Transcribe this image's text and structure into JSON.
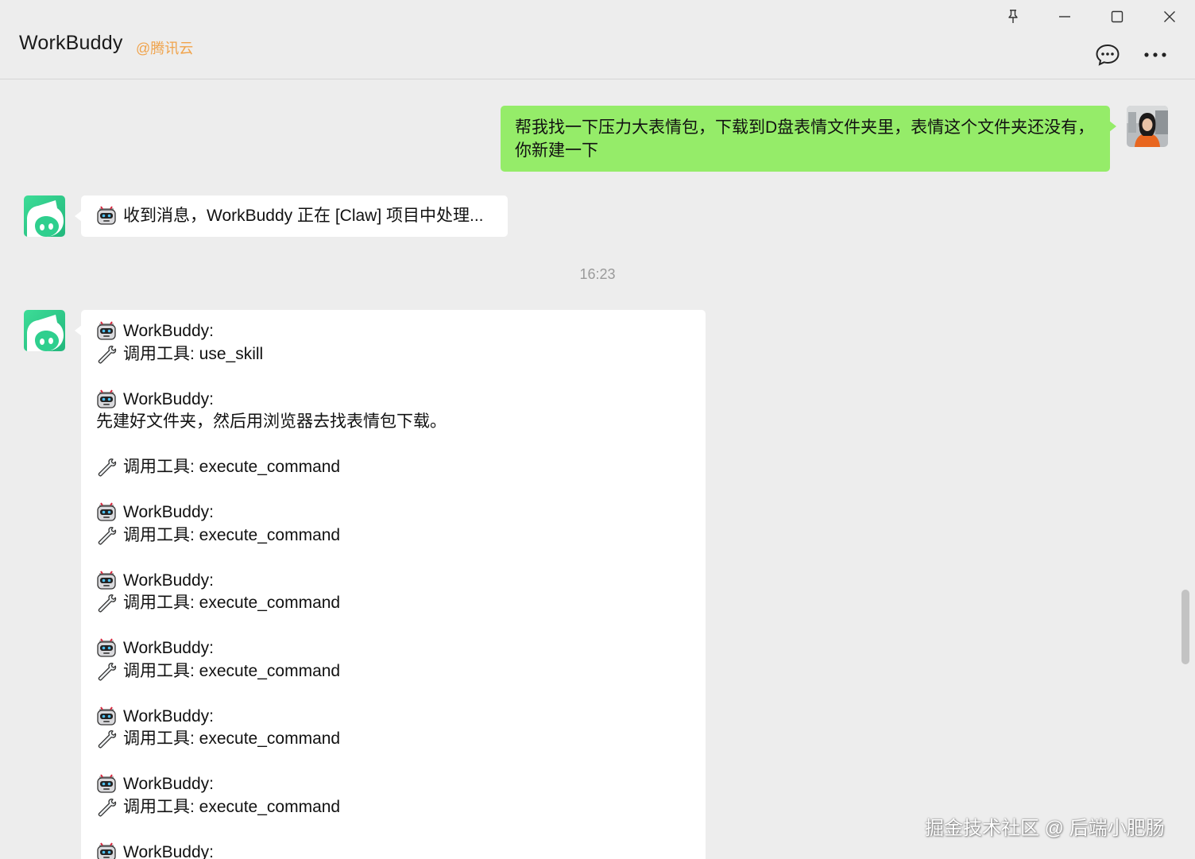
{
  "window": {
    "title": "WorkBuddy",
    "subtitle": "@腾讯云",
    "controls": [
      "pin-icon",
      "minimize-icon",
      "maximize-icon",
      "close-icon"
    ],
    "actions": [
      "chat-icon",
      "more-icon"
    ]
  },
  "colors": {
    "background": "#ededed",
    "user_bubble": "#95ec69",
    "bot_bubble": "#ffffff",
    "subtitle": "#f0a34b",
    "bot_avatar": "#2fcf8e"
  },
  "messages": {
    "user": {
      "lines": [
        "帮我找一下压力大表情包，下载到D盘表情文件夹里，表情这个文件夹还没有，",
        "你新建一下"
      ]
    },
    "bot_ack": {
      "text": "收到消息，WorkBuddy 正在 [Claw] 项目中处理..."
    },
    "timestamp": "16:23",
    "bot_log": [
      {
        "icon": "robot-icon",
        "text": "WorkBuddy:"
      },
      {
        "icon": "wrench-icon",
        "text": "调用工具: use_skill"
      },
      {
        "icon": "robot-icon",
        "text": "WorkBuddy:"
      },
      {
        "icon": "",
        "text": "先建好文件夹，然后用浏览器去找表情包下载。"
      },
      {
        "icon": "wrench-icon",
        "text": "调用工具: execute_command"
      },
      {
        "icon": "robot-icon",
        "text": "WorkBuddy:"
      },
      {
        "icon": "wrench-icon",
        "text": "调用工具: execute_command"
      },
      {
        "icon": "robot-icon",
        "text": "WorkBuddy:"
      },
      {
        "icon": "wrench-icon",
        "text": "调用工具: execute_command"
      },
      {
        "icon": "robot-icon",
        "text": "WorkBuddy:"
      },
      {
        "icon": "wrench-icon",
        "text": "调用工具: execute_command"
      },
      {
        "icon": "robot-icon",
        "text": "WorkBuddy:"
      },
      {
        "icon": "wrench-icon",
        "text": "调用工具: execute_command"
      },
      {
        "icon": "robot-icon",
        "text": "WorkBuddy:"
      },
      {
        "icon": "wrench-icon",
        "text": "调用工具: execute_command"
      },
      {
        "icon": "robot-icon",
        "text": "WorkBuddy:"
      }
    ]
  },
  "watermark": "掘金技术社区 @ 后端小肥肠"
}
